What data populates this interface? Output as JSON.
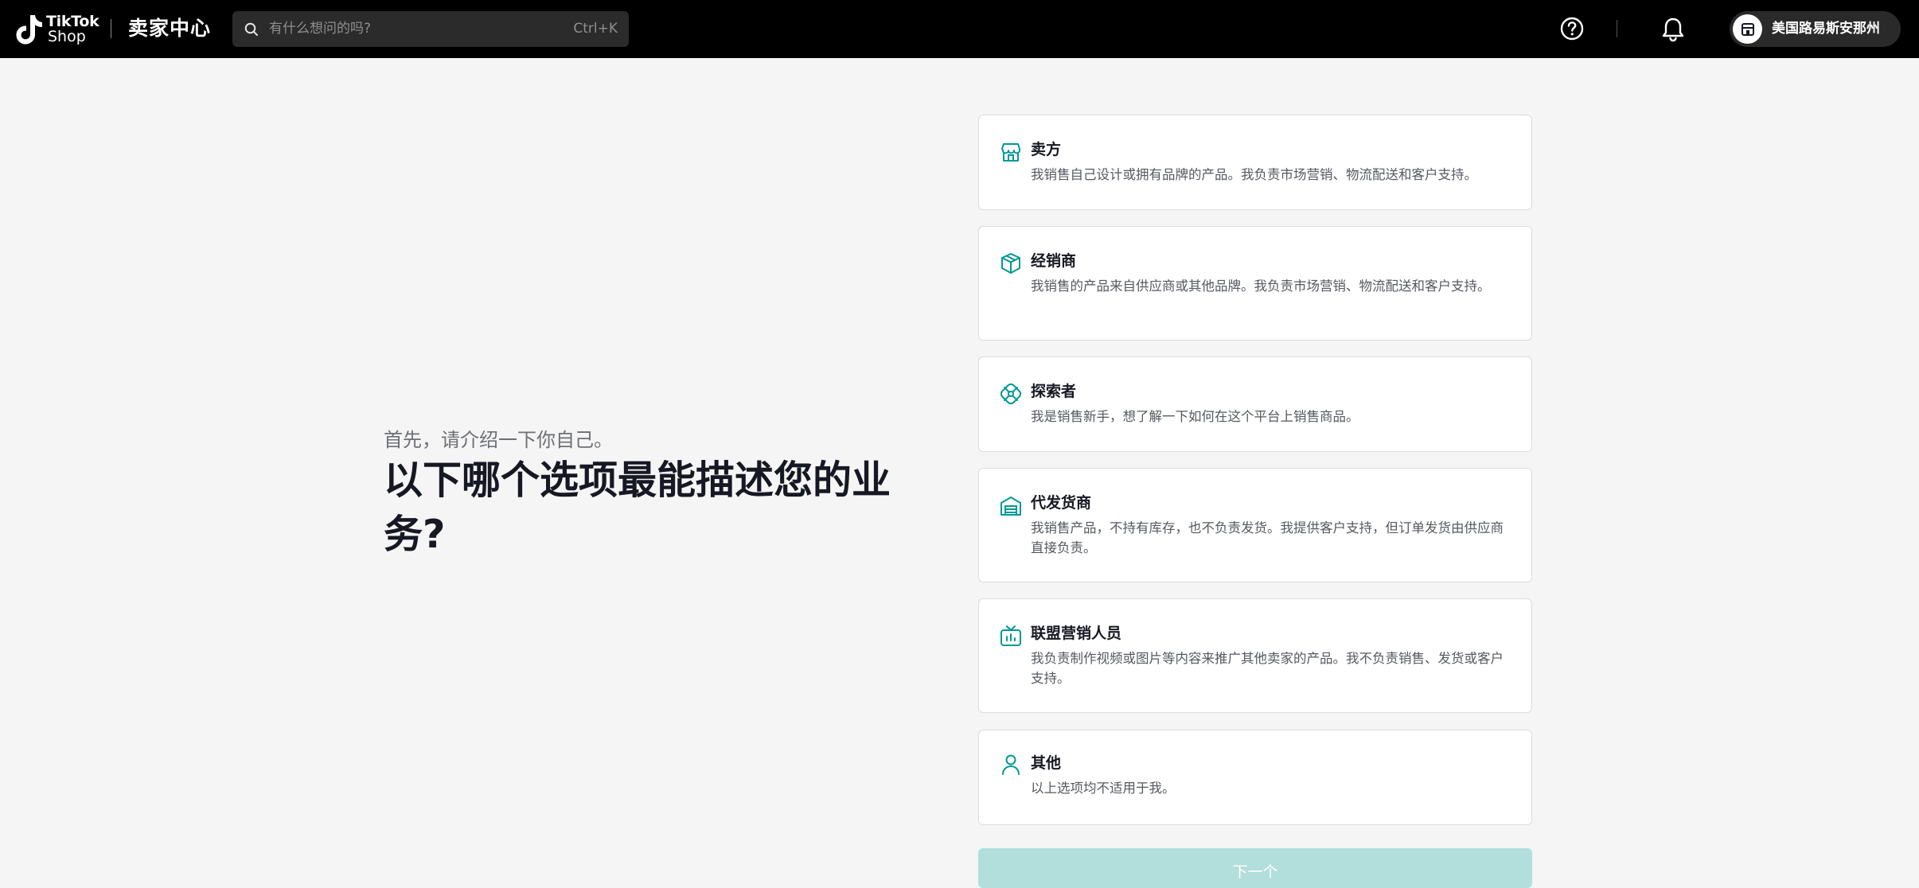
{
  "header": {
    "logo_line1": "TikTok",
    "logo_line2": "Shop",
    "app_title": "卖家中心",
    "search_placeholder": "有什么想问的吗?",
    "search_shortcut": "Ctrl+K",
    "account_name": "美国路易斯安那州"
  },
  "main": {
    "intro": "首先，请介绍一下你自己。",
    "question": "以下哪个选项最能描述您的业务?",
    "options": [
      {
        "title": "卖方",
        "desc": "我销售自己设计或拥有品牌的产品。我负责市场营销、物流配送和客户支持。",
        "icon": "store-icon"
      },
      {
        "title": "经销商",
        "desc": "我销售的产品来自供应商或其他品牌。我负责市场营销、物流配送和客户支持。",
        "icon": "box-icon"
      },
      {
        "title": "探索者",
        "desc": "我是销售新手，想了解一下如何在这个平台上销售商品。",
        "icon": "explorer-icon"
      },
      {
        "title": "代发货商",
        "desc": "我销售产品，不持有库存，也不负责发货。我提供客户支持，但订单发货由供应商直接负责。",
        "icon": "warehouse-icon"
      },
      {
        "title": "联盟营销人员",
        "desc": "我负责制作视频或图片等内容来推广其他卖家的产品。我不负责销售、发货或客户支持。",
        "icon": "tv-icon"
      },
      {
        "title": "其他",
        "desc": "以上选项均不适用于我。",
        "icon": "person-icon"
      }
    ],
    "next_label": "下一个"
  },
  "colors": {
    "accent": "#009995",
    "button_disabled": "#b2dfdb",
    "topbar": "#000000"
  }
}
